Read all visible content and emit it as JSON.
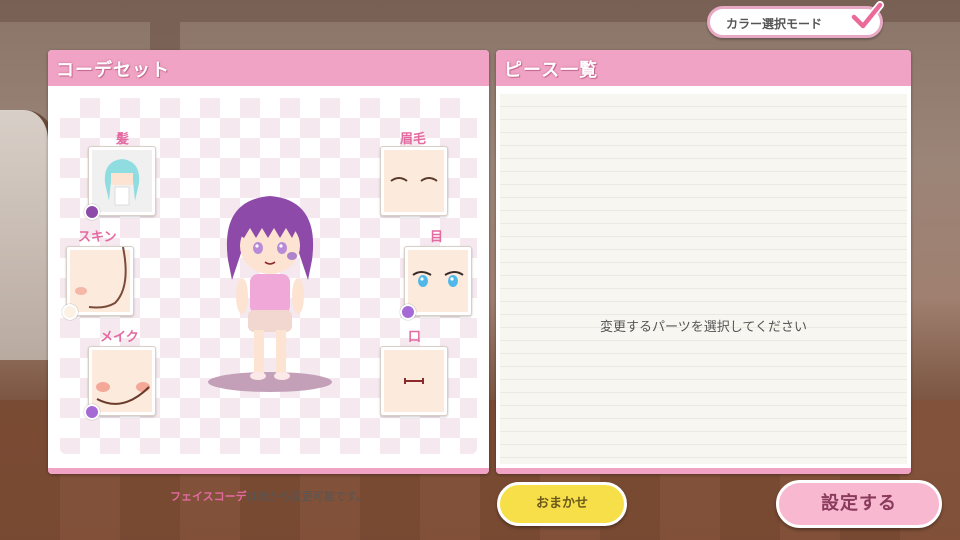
{
  "left_panel": {
    "title": "コーデセット",
    "slots": {
      "hair": "髪",
      "skin": "スキン",
      "makeup": "メイク",
      "eyebrows": "眉毛",
      "eyes": "目",
      "mouth": "口"
    },
    "note_highlight": "フェイスコーデ",
    "note_rest": "は後から変更可能です。"
  },
  "right_panel": {
    "title": "ピース一覧",
    "message": "変更するパーツを選択してください"
  },
  "mode_toggle": {
    "label": "カラー選択モード",
    "checked": true
  },
  "buttons": {
    "random": "おまかせ",
    "confirm": "設定する"
  },
  "colors": {
    "accent_pink": "#f0a3c4",
    "hair_purple": "#8e4aa8",
    "swatch_purple": "#a56ad6",
    "random_yellow": "#f7df4a"
  }
}
